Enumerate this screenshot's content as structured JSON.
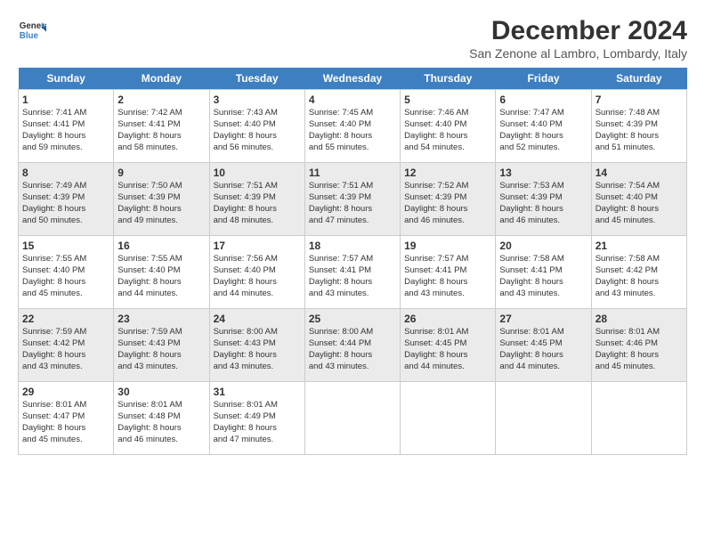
{
  "header": {
    "title": "December 2024",
    "subtitle": "San Zenone al Lambro, Lombardy, Italy",
    "logo_line1": "General",
    "logo_line2": "Blue"
  },
  "days_of_week": [
    "Sunday",
    "Monday",
    "Tuesday",
    "Wednesday",
    "Thursday",
    "Friday",
    "Saturday"
  ],
  "weeks": [
    [
      {
        "day": 1,
        "lines": [
          "Sunrise: 7:41 AM",
          "Sunset: 4:41 PM",
          "Daylight: 8 hours",
          "and 59 minutes."
        ]
      },
      {
        "day": 2,
        "lines": [
          "Sunrise: 7:42 AM",
          "Sunset: 4:41 PM",
          "Daylight: 8 hours",
          "and 58 minutes."
        ]
      },
      {
        "day": 3,
        "lines": [
          "Sunrise: 7:43 AM",
          "Sunset: 4:40 PM",
          "Daylight: 8 hours",
          "and 56 minutes."
        ]
      },
      {
        "day": 4,
        "lines": [
          "Sunrise: 7:45 AM",
          "Sunset: 4:40 PM",
          "Daylight: 8 hours",
          "and 55 minutes."
        ]
      },
      {
        "day": 5,
        "lines": [
          "Sunrise: 7:46 AM",
          "Sunset: 4:40 PM",
          "Daylight: 8 hours",
          "and 54 minutes."
        ]
      },
      {
        "day": 6,
        "lines": [
          "Sunrise: 7:47 AM",
          "Sunset: 4:40 PM",
          "Daylight: 8 hours",
          "and 52 minutes."
        ]
      },
      {
        "day": 7,
        "lines": [
          "Sunrise: 7:48 AM",
          "Sunset: 4:39 PM",
          "Daylight: 8 hours",
          "and 51 minutes."
        ]
      }
    ],
    [
      {
        "day": 8,
        "lines": [
          "Sunrise: 7:49 AM",
          "Sunset: 4:39 PM",
          "Daylight: 8 hours",
          "and 50 minutes."
        ]
      },
      {
        "day": 9,
        "lines": [
          "Sunrise: 7:50 AM",
          "Sunset: 4:39 PM",
          "Daylight: 8 hours",
          "and 49 minutes."
        ]
      },
      {
        "day": 10,
        "lines": [
          "Sunrise: 7:51 AM",
          "Sunset: 4:39 PM",
          "Daylight: 8 hours",
          "and 48 minutes."
        ]
      },
      {
        "day": 11,
        "lines": [
          "Sunrise: 7:51 AM",
          "Sunset: 4:39 PM",
          "Daylight: 8 hours",
          "and 47 minutes."
        ]
      },
      {
        "day": 12,
        "lines": [
          "Sunrise: 7:52 AM",
          "Sunset: 4:39 PM",
          "Daylight: 8 hours",
          "and 46 minutes."
        ]
      },
      {
        "day": 13,
        "lines": [
          "Sunrise: 7:53 AM",
          "Sunset: 4:39 PM",
          "Daylight: 8 hours",
          "and 46 minutes."
        ]
      },
      {
        "day": 14,
        "lines": [
          "Sunrise: 7:54 AM",
          "Sunset: 4:40 PM",
          "Daylight: 8 hours",
          "and 45 minutes."
        ]
      }
    ],
    [
      {
        "day": 15,
        "lines": [
          "Sunrise: 7:55 AM",
          "Sunset: 4:40 PM",
          "Daylight: 8 hours",
          "and 45 minutes."
        ]
      },
      {
        "day": 16,
        "lines": [
          "Sunrise: 7:55 AM",
          "Sunset: 4:40 PM",
          "Daylight: 8 hours",
          "and 44 minutes."
        ]
      },
      {
        "day": 17,
        "lines": [
          "Sunrise: 7:56 AM",
          "Sunset: 4:40 PM",
          "Daylight: 8 hours",
          "and 44 minutes."
        ]
      },
      {
        "day": 18,
        "lines": [
          "Sunrise: 7:57 AM",
          "Sunset: 4:41 PM",
          "Daylight: 8 hours",
          "and 43 minutes."
        ]
      },
      {
        "day": 19,
        "lines": [
          "Sunrise: 7:57 AM",
          "Sunset: 4:41 PM",
          "Daylight: 8 hours",
          "and 43 minutes."
        ]
      },
      {
        "day": 20,
        "lines": [
          "Sunrise: 7:58 AM",
          "Sunset: 4:41 PM",
          "Daylight: 8 hours",
          "and 43 minutes."
        ]
      },
      {
        "day": 21,
        "lines": [
          "Sunrise: 7:58 AM",
          "Sunset: 4:42 PM",
          "Daylight: 8 hours",
          "and 43 minutes."
        ]
      }
    ],
    [
      {
        "day": 22,
        "lines": [
          "Sunrise: 7:59 AM",
          "Sunset: 4:42 PM",
          "Daylight: 8 hours",
          "and 43 minutes."
        ]
      },
      {
        "day": 23,
        "lines": [
          "Sunrise: 7:59 AM",
          "Sunset: 4:43 PM",
          "Daylight: 8 hours",
          "and 43 minutes."
        ]
      },
      {
        "day": 24,
        "lines": [
          "Sunrise: 8:00 AM",
          "Sunset: 4:43 PM",
          "Daylight: 8 hours",
          "and 43 minutes."
        ]
      },
      {
        "day": 25,
        "lines": [
          "Sunrise: 8:00 AM",
          "Sunset: 4:44 PM",
          "Daylight: 8 hours",
          "and 43 minutes."
        ]
      },
      {
        "day": 26,
        "lines": [
          "Sunrise: 8:01 AM",
          "Sunset: 4:45 PM",
          "Daylight: 8 hours",
          "and 44 minutes."
        ]
      },
      {
        "day": 27,
        "lines": [
          "Sunrise: 8:01 AM",
          "Sunset: 4:45 PM",
          "Daylight: 8 hours",
          "and 44 minutes."
        ]
      },
      {
        "day": 28,
        "lines": [
          "Sunrise: 8:01 AM",
          "Sunset: 4:46 PM",
          "Daylight: 8 hours",
          "and 45 minutes."
        ]
      }
    ],
    [
      {
        "day": 29,
        "lines": [
          "Sunrise: 8:01 AM",
          "Sunset: 4:47 PM",
          "Daylight: 8 hours",
          "and 45 minutes."
        ]
      },
      {
        "day": 30,
        "lines": [
          "Sunrise: 8:01 AM",
          "Sunset: 4:48 PM",
          "Daylight: 8 hours",
          "and 46 minutes."
        ]
      },
      {
        "day": 31,
        "lines": [
          "Sunrise: 8:01 AM",
          "Sunset: 4:49 PM",
          "Daylight: 8 hours",
          "and 47 minutes."
        ]
      },
      null,
      null,
      null,
      null
    ]
  ]
}
